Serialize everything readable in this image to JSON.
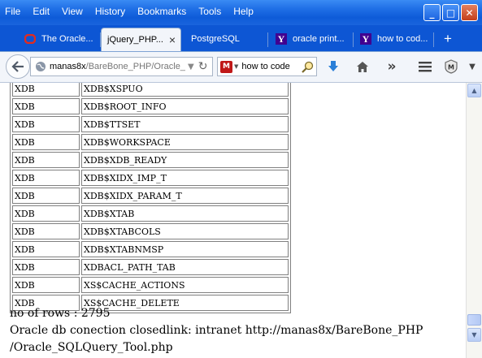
{
  "menu": {
    "items": [
      "File",
      "Edit",
      "View",
      "History",
      "Bookmarks",
      "Tools",
      "Help"
    ]
  },
  "window_controls": {
    "minimize": "_",
    "maximize": "□",
    "close": "✕"
  },
  "tabs": [
    {
      "label": "The Oracle...",
      "icon": "oracle-icon",
      "icon_color": "#e02b20"
    },
    {
      "label": "jQuery_PHP...",
      "icon": "none",
      "active": true
    },
    {
      "label": "PostgreSQL",
      "icon": "none"
    },
    {
      "label": "oracle print...",
      "icon": "yahoo-icon",
      "icon_color": "#400090"
    },
    {
      "label": "how to cod...",
      "icon": "yahoo-icon",
      "icon_color": "#400090"
    }
  ],
  "tab_close": "×",
  "new_tab": "+",
  "navbar": {
    "url_host": "manas8x",
    "url_rest": "/BareBone_PHP/Oracle_",
    "search_value": "how to code",
    "search_engine_badge": "M"
  },
  "table": {
    "rows": [
      [
        "XDB",
        "XDB$XSPUO"
      ],
      [
        "XDB",
        "XDB$ROOT_INFO"
      ],
      [
        "XDB",
        "XDB$TTSET"
      ],
      [
        "XDB",
        "XDB$WORKSPACE"
      ],
      [
        "XDB",
        "XDB$XDB_READY"
      ],
      [
        "XDB",
        "XDB$XIDX_IMP_T"
      ],
      [
        "XDB",
        "XDB$XIDX_PARAM_T"
      ],
      [
        "XDB",
        "XDB$XTAB"
      ],
      [
        "XDB",
        "XDB$XTABCOLS"
      ],
      [
        "XDB",
        "XDB$XTABNMSP"
      ],
      [
        "XDB",
        "XDBACL_PATH_TAB"
      ],
      [
        "XDB",
        "XS$CACHE_ACTIONS"
      ],
      [
        "XDB",
        "XS$CACHE_DELETE"
      ]
    ]
  },
  "footer": {
    "rows_count": "no of rows : 2795",
    "status_line1": "Oracle db conection closedlink: intranet http://manas8x/BareBone_PHP",
    "status_line2": "/Oracle_SQLQuery_Tool.php"
  },
  "colors": {
    "titlebar": "#1f6fe6",
    "close_button": "#c33f1b"
  }
}
